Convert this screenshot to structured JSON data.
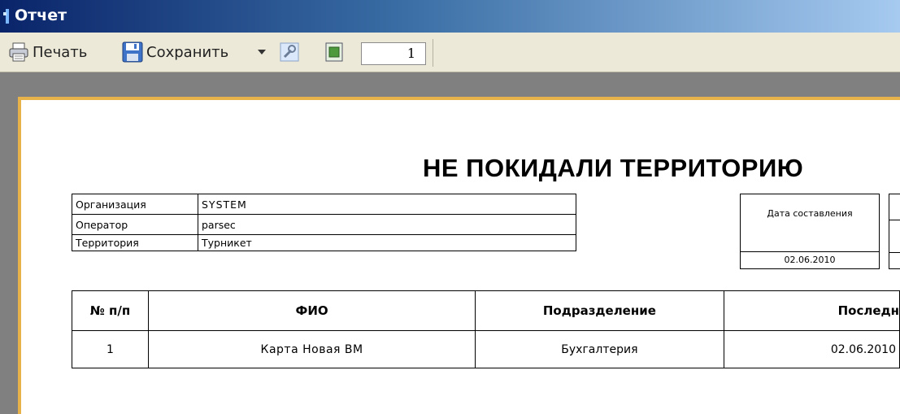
{
  "window": {
    "title": "Отчет"
  },
  "toolbar": {
    "print_label": "Печать",
    "save_label": "Сохранить",
    "page_value": "1"
  },
  "report": {
    "title": "НЕ ПОКИДАЛИ ТЕРРИТОРИЮ",
    "info": [
      {
        "label": "Организация",
        "value": "SYSTEM"
      },
      {
        "label": "Оператор",
        "value": "parsec"
      },
      {
        "label": "Территория",
        "value": "Турникет"
      }
    ],
    "date_label": "Дата составления",
    "date_value": "02.06.2010",
    "columns": [
      "№ п/п",
      "ФИО",
      "Подразделение",
      "Последн"
    ],
    "rows": [
      [
        "1",
        "Карта Новая ВМ",
        "Бухгалтерия",
        "02.06.2010"
      ]
    ]
  }
}
